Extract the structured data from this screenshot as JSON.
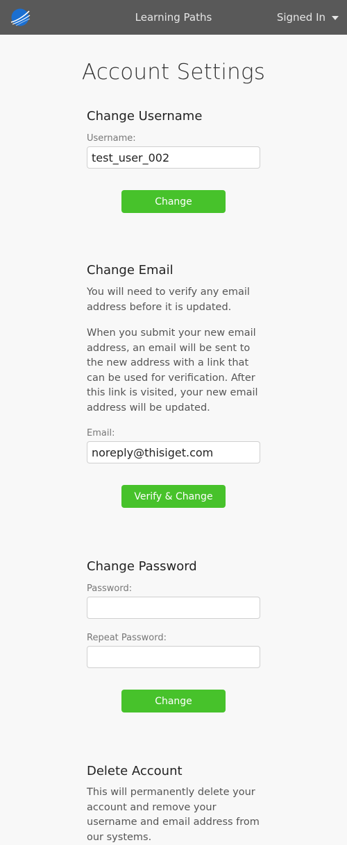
{
  "navbar": {
    "logo_icon": "globe-logo-icon",
    "center_link": "Learning Paths",
    "user_menu_label": "Signed In",
    "background": "#595959"
  },
  "page": {
    "title": "Account Settings"
  },
  "username_section": {
    "heading": "Change Username",
    "field_label": "Username:",
    "field_value": "test_user_002",
    "button_label": "Change"
  },
  "email_section": {
    "heading": "Change Email",
    "paragraph_1": "You will need to verify any email address before it is updated.",
    "paragraph_2": "When you submit your new email address, an email will be sent to the new address with a link that can be used for verification. After this link is visited, your new email address will be updated.",
    "field_label": "Email:",
    "field_value": "noreply@thisiget.com",
    "button_label": "Verify & Change"
  },
  "password_section": {
    "heading": "Change Password",
    "password_label": "Password:",
    "password_value": "",
    "repeat_label": "Repeat Password:",
    "repeat_value": "",
    "button_label": "Change"
  },
  "delete_section": {
    "heading": "Delete Account",
    "paragraph": "This will permanently delete your account and remove your username and email address from our systems."
  },
  "colors": {
    "accent_green": "#47c22b",
    "logo_blue": "#1b6fd1"
  }
}
